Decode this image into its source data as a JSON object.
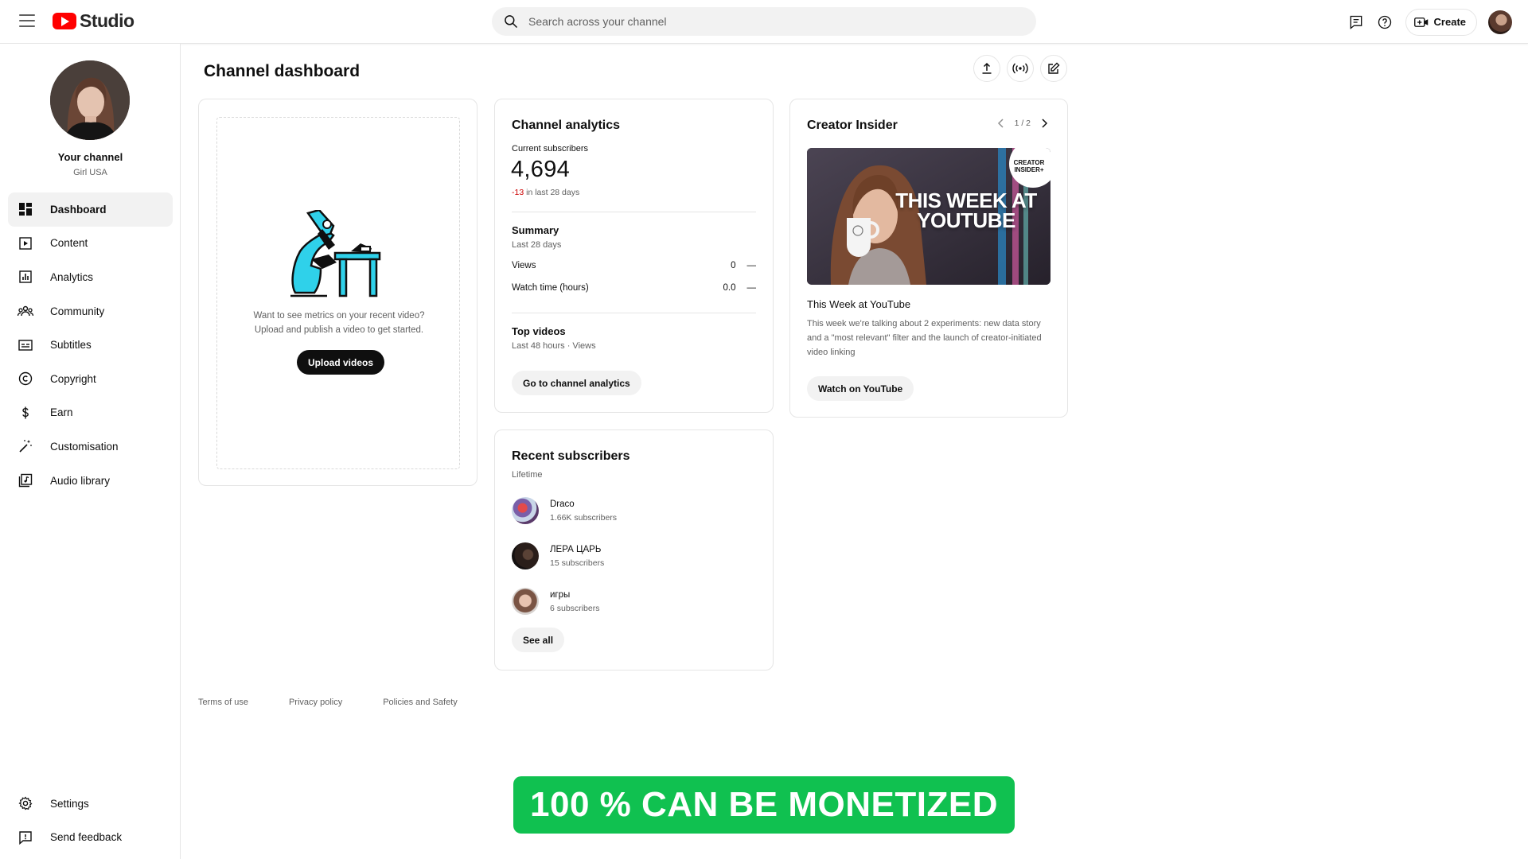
{
  "app": {
    "logo_text": "Studio",
    "brand_color": "#ff0000"
  },
  "search": {
    "placeholder": "Search across your channel"
  },
  "header": {
    "create_label": "Create"
  },
  "channel": {
    "name": "Your channel",
    "subtitle": "Girl USA"
  },
  "sidebar": {
    "items": [
      {
        "label": "Dashboard",
        "icon": "dashboard-icon",
        "active": true
      },
      {
        "label": "Content",
        "icon": "content-icon"
      },
      {
        "label": "Analytics",
        "icon": "analytics-icon"
      },
      {
        "label": "Community",
        "icon": "community-icon"
      },
      {
        "label": "Subtitles",
        "icon": "subtitles-icon"
      },
      {
        "label": "Copyright",
        "icon": "copyright-icon"
      },
      {
        "label": "Earn",
        "icon": "dollar-icon"
      },
      {
        "label": "Customisation",
        "icon": "magic-wand-icon"
      },
      {
        "label": "Audio library",
        "icon": "audio-library-icon"
      }
    ],
    "bottom": [
      {
        "label": "Settings",
        "icon": "gear-icon"
      },
      {
        "label": "Send feedback",
        "icon": "feedback-icon"
      }
    ]
  },
  "page": {
    "title": "Channel dashboard"
  },
  "upload_card": {
    "text_line1": "Want to see metrics on your recent video?",
    "text_line2": "Upload and publish a video to get started.",
    "button": "Upload videos"
  },
  "analytics": {
    "title": "Channel analytics",
    "current_subs_label": "Current subscribers",
    "current_subs": "4,694",
    "delta": "-13",
    "delta_suffix": " in last 28 days",
    "summary_title": "Summary",
    "summary_period": "Last 28 days",
    "metrics": [
      {
        "label": "Views",
        "value": "0",
        "trend": "—"
      },
      {
        "label": "Watch time (hours)",
        "value": "0.0",
        "trend": "—"
      }
    ],
    "top_videos_title": "Top videos",
    "top_videos_period": "Last 48 hours · Views",
    "button": "Go to channel analytics"
  },
  "subscribers": {
    "title": "Recent subscribers",
    "period": "Lifetime",
    "items": [
      {
        "name": "Draco",
        "count": "1.66K subscribers"
      },
      {
        "name": "ЛЕРА ЦАРЬ",
        "count": "15 subscribers"
      },
      {
        "name": "игры",
        "count": "6 subscribers"
      }
    ],
    "button": "See all"
  },
  "insider": {
    "title": "Creator Insider",
    "pager": "1 / 2",
    "thumb_headline": "THIS WEEK AT YOUTUBE",
    "thumb_badge": "CREATOR INSIDER+",
    "video_title": "This Week at YouTube",
    "description": "This week we're talking about 2 experiments: new data story and a \"most relevant\" filter and the launch of creator-initiated video linking",
    "button": "Watch on YouTube"
  },
  "footer": {
    "terms": "Terms of use",
    "privacy": "Privacy policy",
    "policies": "Policies and Safety"
  },
  "promo": {
    "text": "100 % CAN BE MONETIZED",
    "color": "#10c150"
  }
}
